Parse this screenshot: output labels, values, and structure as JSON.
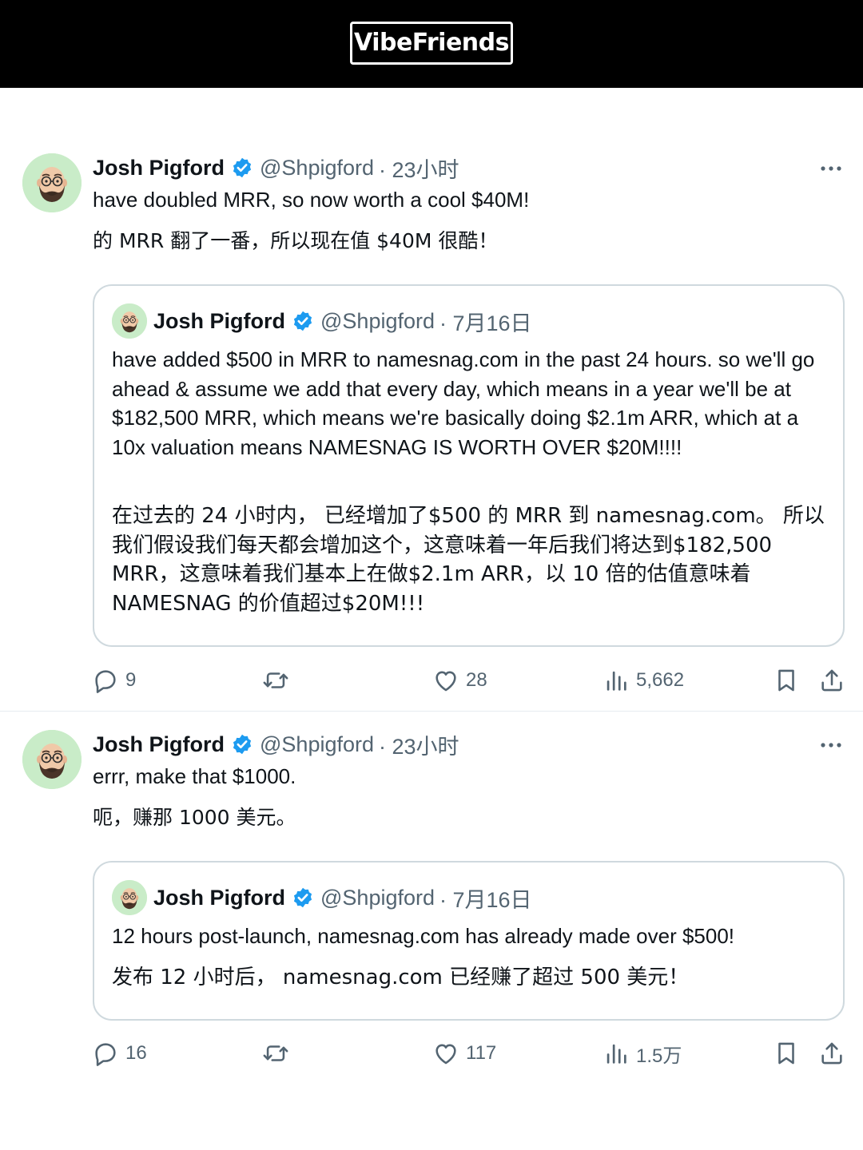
{
  "app": {
    "brand": "VibeFriends"
  },
  "colors": {
    "verified": "#1d9bf0",
    "avatar_bg": "#c9ecc8",
    "secondary_text": "#536471",
    "border": "#cfd9de"
  },
  "tweets": [
    {
      "author": {
        "name": "Josh Pigford",
        "handle": "@Shpigford",
        "time": "· 23小时",
        "verified_icon": "verified-badge-icon"
      },
      "text_en": "have doubled MRR, so now worth a cool $40M!",
      "text_cn": "的 MRR 翻了一番，所以现在值 $40M 很酷！",
      "quote": {
        "author": {
          "name": "Josh Pigford",
          "handle": "@Shpigford",
          "time": "· 7月16日"
        },
        "text_en": "have added $500 in MRR to namesnag.com in the past 24 hours. so we'll go ahead & assume we add that every day, which means in a year we'll be at $182,500 MRR, which means we're basically doing $2.1m ARR, which at a 10x valuation means NAMESNAG IS WORTH OVER $20M!!!!",
        "text_cn": "在过去的 24 小时内， 已经增加了$500 的 MRR 到 namesnag.com。 所以我们假设我们每天都会增加这个，这意味着一年后我们将达到$182,500 MRR，这意味着我们基本上在做$2.1m ARR，以 10 倍的估值意味着 NAMESNAG 的价值超过$20M!!!"
      },
      "actions": {
        "replies": "9",
        "likes": "28",
        "views": "5,662"
      }
    },
    {
      "author": {
        "name": "Josh Pigford",
        "handle": "@Shpigford",
        "time": "· 23小时",
        "verified_icon": "verified-badge-icon"
      },
      "text_en": "errr, make that $1000.",
      "text_cn": "呃，赚那 1000 美元。",
      "quote": {
        "author": {
          "name": "Josh Pigford",
          "handle": "@Shpigford",
          "time": "· 7月16日"
        },
        "text_en": "12 hours post-launch, namesnag.com has already made over $500!",
        "text_cn": "发布 12 小时后， namesnag.com 已经赚了超过 500 美元！"
      },
      "actions": {
        "replies": "16",
        "likes": "117",
        "views": "1.5万"
      }
    }
  ]
}
